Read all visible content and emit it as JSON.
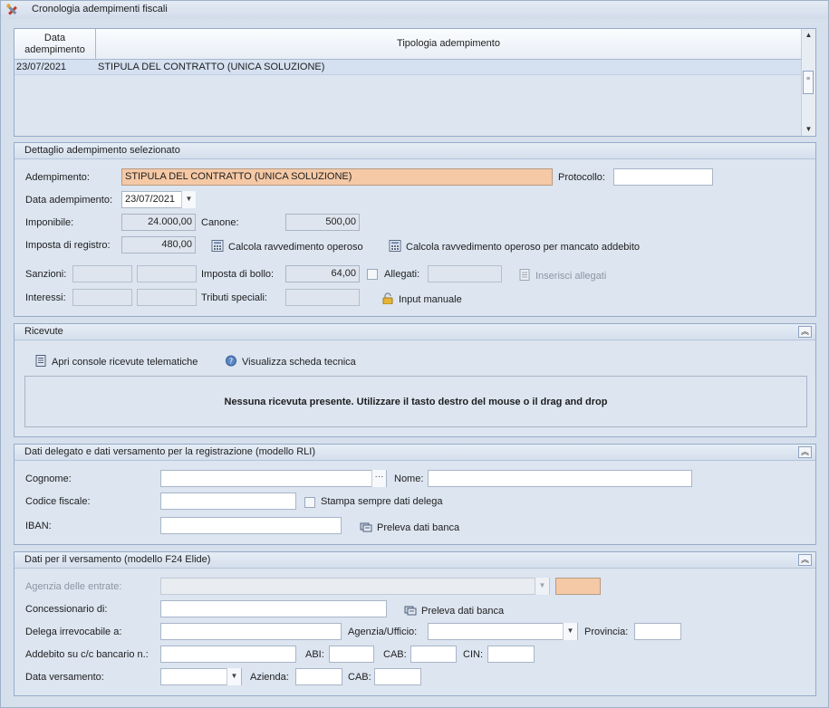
{
  "window": {
    "title": "Cronologia adempimenti fiscali",
    "icon": "tools-icon"
  },
  "grid": {
    "headers": [
      "Data\nadempimento",
      "Tipologia adempimento"
    ],
    "rows": [
      {
        "date": "23/07/2021",
        "type": "STIPULA DEL CONTRATTO (UNICA SOLUZIONE)"
      }
    ]
  },
  "detail": {
    "title": "Dettaglio adempimento selezionato",
    "adempimento_label": "Adempimento:",
    "adempimento_value": "STIPULA DEL CONTRATTO (UNICA SOLUZIONE)",
    "protocollo_label": "Protocollo:",
    "protocollo_value": "",
    "data_label": "Data adempimento:",
    "data_value": "23/07/2021",
    "imponibile_label": "Imponibile:",
    "imponibile_value": "24.000,00",
    "canone_label": "Canone:",
    "canone_value": "500,00",
    "imposta_registro_label": "Imposta di registro:",
    "imposta_registro_value": "480,00",
    "calcola_label": "Calcola ravvedimento operoso",
    "calcola_mancato_label": "Calcola ravvedimento operoso per mancato addebito",
    "sanzioni_label": "Sanzioni:",
    "interessi_label": "Interessi:",
    "imposta_bollo_label": "Imposta di bollo:",
    "imposta_bollo_value": "64,00",
    "tributi_label": "Tributi speciali:",
    "allegati_label": "Allegati:",
    "inserisci_allegati_label": "Inserisci allegati",
    "input_manuale_label": "Input manuale"
  },
  "ricevute": {
    "title": "Ricevute",
    "console_label": "Apri console ricevute telematiche",
    "scheda_label": "Visualizza scheda tecnica",
    "empty_message": "Nessuna ricevuta presente. Utilizzare il tasto destro del mouse o il drag and drop"
  },
  "delegato": {
    "title": "Dati delegato e dati versamento per la registrazione (modello RLI)",
    "cognome_label": "Cognome:",
    "nome_label": "Nome:",
    "codice_fiscale_label": "Codice fiscale:",
    "stampa_label": "Stampa sempre dati delega",
    "iban_label": "IBAN:",
    "preleva_label": "Preleva dati banca"
  },
  "f24": {
    "title": "Dati per il versamento (modello F24 Elide)",
    "agenzia_entrate_label": "Agenzia delle entrate:",
    "concessionario_label": "Concessionario di:",
    "preleva_label": "Preleva dati banca",
    "delega_label": "Delega irrevocabile a:",
    "agenzia_ufficio_label": "Agenzia/Ufficio:",
    "provincia_label": "Provincia:",
    "addebito_label": "Addebito su c/c bancario n.:",
    "abi_label": "ABI:",
    "cab_label": "CAB:",
    "cin_label": "CIN:",
    "data_versamento_label": "Data versamento:",
    "azienda_label": "Azienda:",
    "cab2_label": "CAB:"
  },
  "colors": {
    "highlight": "#f5c9a6",
    "panel_bg": "#dce5f0",
    "border": "#97abc8"
  }
}
